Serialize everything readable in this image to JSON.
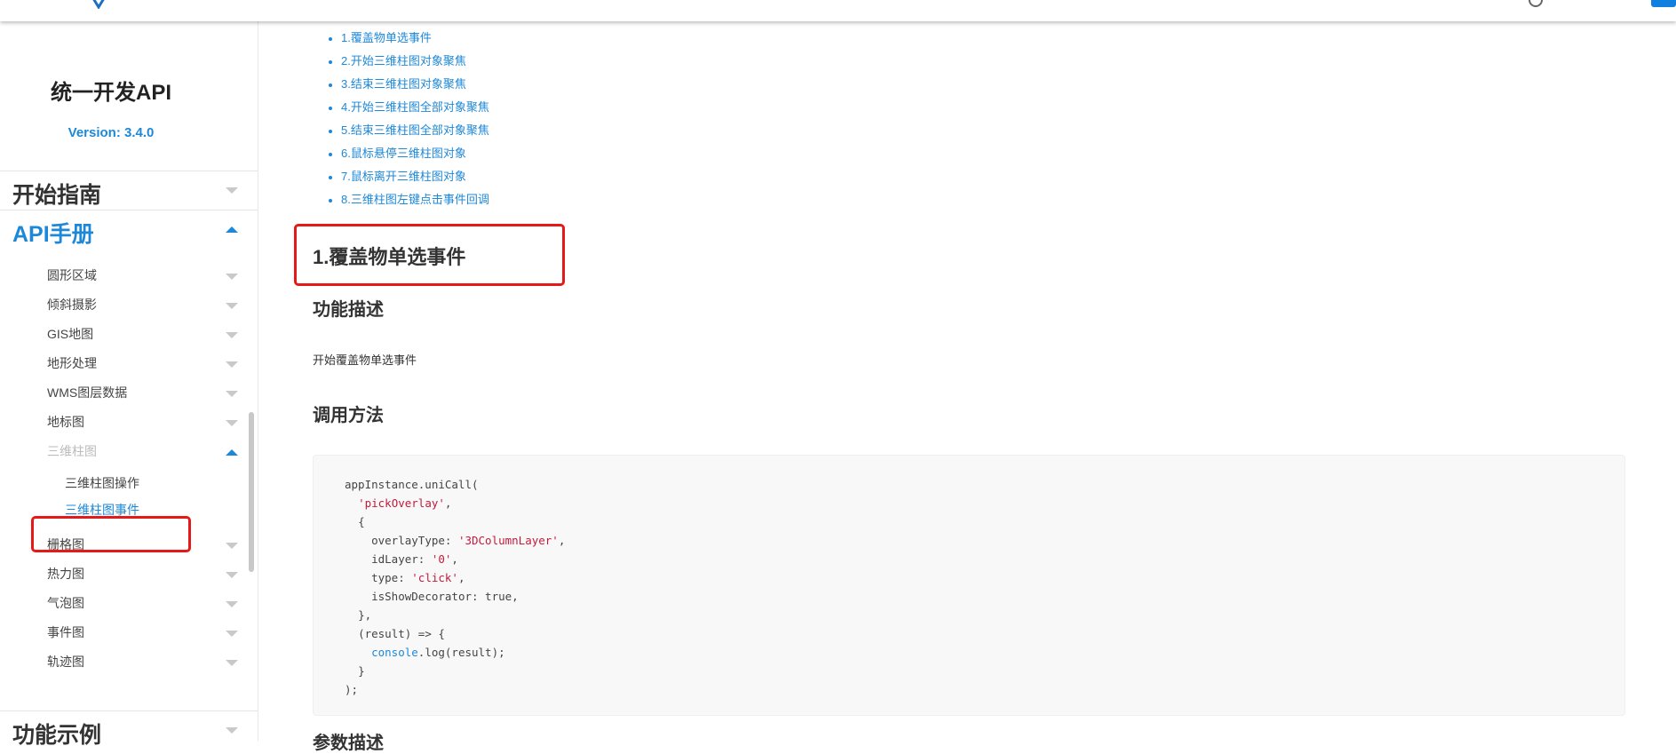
{
  "sidebar": {
    "title": "统一开发API",
    "version": "Version: 3.4.0",
    "sections": [
      {
        "label": "开始指南"
      },
      {
        "label": "API手册"
      },
      {
        "label": "功能示例"
      }
    ],
    "items": [
      {
        "label": "圆形区域"
      },
      {
        "label": "倾斜摄影"
      },
      {
        "label": "GIS地图"
      },
      {
        "label": "地形处理"
      },
      {
        "label": "WMS图层数据"
      },
      {
        "label": "地标图"
      },
      {
        "label": "三维柱图"
      },
      {
        "label": "栅格图"
      },
      {
        "label": "热力图"
      },
      {
        "label": "气泡图"
      },
      {
        "label": "事件图"
      },
      {
        "label": "轨迹图"
      }
    ],
    "sub_items": [
      {
        "label": "三维柱图操作"
      },
      {
        "label": "三维柱图事件"
      }
    ]
  },
  "toc": [
    "1.覆盖物单选事件",
    "2.开始三维柱图对象聚焦",
    "3.结束三维柱图对象聚焦",
    "4.开始三维柱图全部对象聚焦",
    "5.结束三维柱图全部对象聚焦",
    "6.鼠标悬停三维柱图对象",
    "7.鼠标离开三维柱图对象",
    "8.三维柱图左键点击事件回调"
  ],
  "content": {
    "heading": "1.覆盖物单选事件",
    "desc_title": "功能描述",
    "desc_text": "开始覆盖物单选事件",
    "call_title": "调用方法",
    "param_title": "参数描述"
  },
  "code": {
    "l1": "appInstance.uniCall(",
    "l2_str": "'pickOverlay'",
    "l2_rest": ",",
    "l3": "{",
    "l4_key": "overlayType: ",
    "l4_str": "'3DColumnLayer'",
    "l4_rest": ",",
    "l5_key": "idLayer: ",
    "l5_str": "'0'",
    "l5_rest": ",",
    "l6_key": "type: ",
    "l6_str": "'click'",
    "l6_rest": ",",
    "l7": "isShowDecorator: true,",
    "l8": "},",
    "l9": "(result) => {",
    "l10_fn": "console",
    "l10_rest": ".log(result);",
    "l11": "}",
    "l12": ");"
  }
}
